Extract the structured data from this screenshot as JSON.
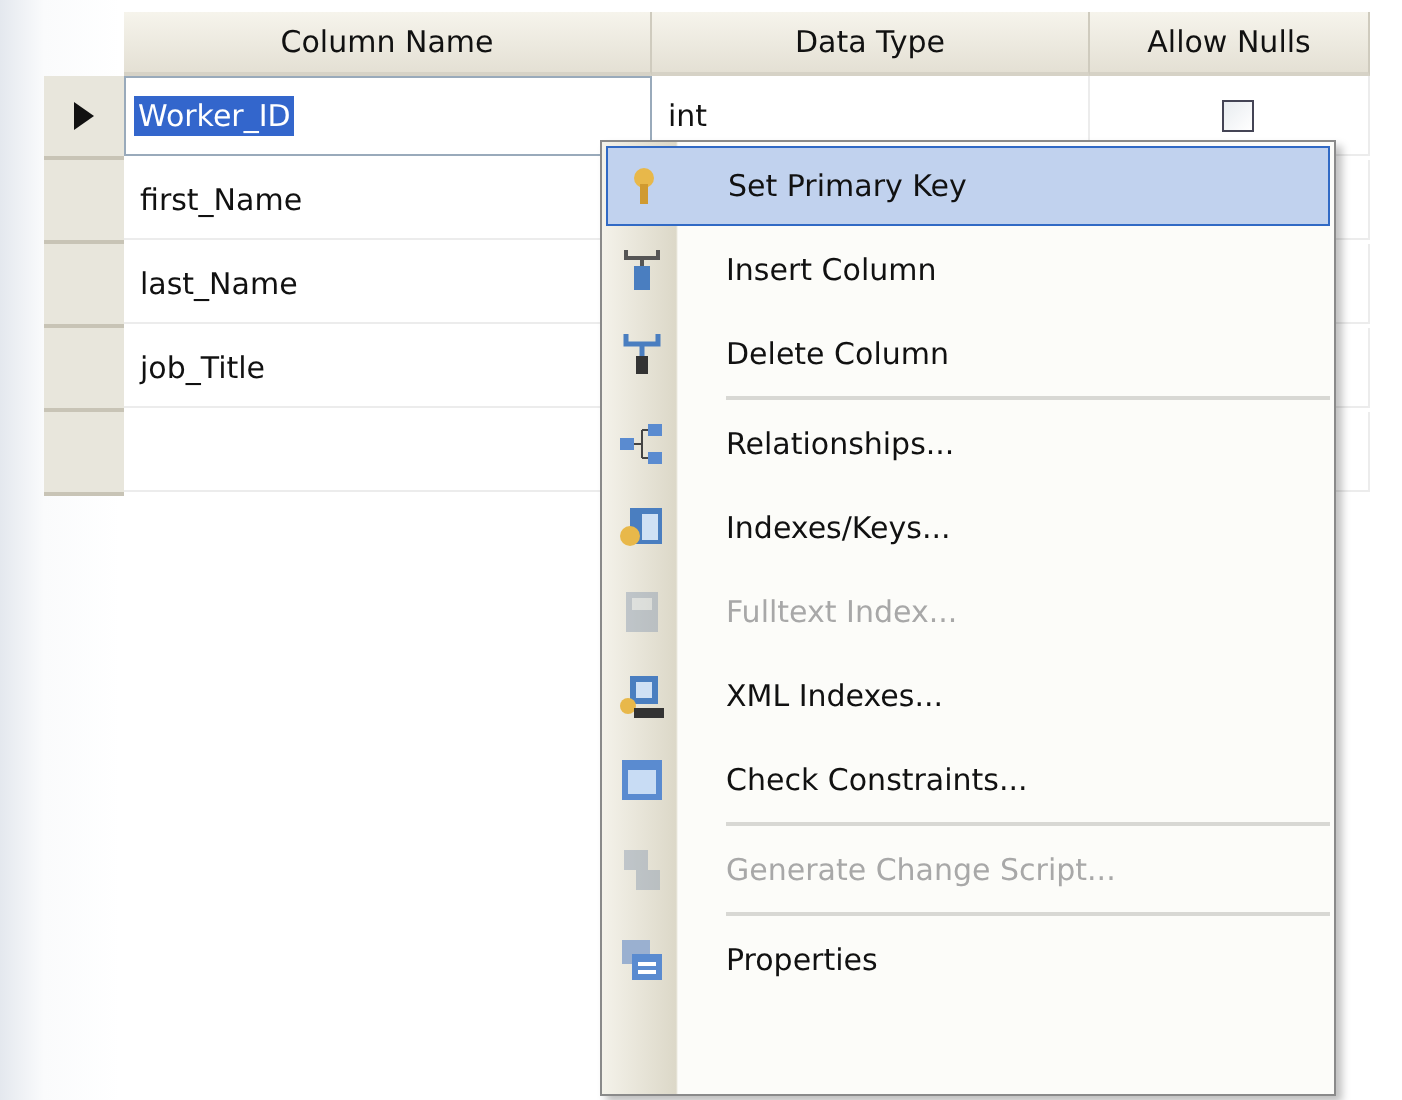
{
  "table": {
    "columns": [
      "Column Name",
      "Data Type",
      "Allow Nulls"
    ],
    "rows": [
      {
        "selected": true,
        "column_name": "Worker_ID",
        "data_type": "int",
        "allow_nulls": false
      },
      {
        "selected": false,
        "column_name": "first_Name"
      },
      {
        "selected": false,
        "column_name": "last_Name"
      },
      {
        "selected": false,
        "column_name": "job_Title"
      },
      {
        "selected": false
      }
    ]
  },
  "context_menu": {
    "items": [
      {
        "label": "Set Primary Key",
        "selected": true,
        "disabled": false
      },
      {
        "label": "Insert Column",
        "selected": false,
        "disabled": false
      },
      {
        "label": "Delete Column",
        "selected": false,
        "disabled": false,
        "separator_after": true
      },
      {
        "label": "Relationships...",
        "selected": false,
        "disabled": false
      },
      {
        "label": "Indexes/Keys...",
        "selected": false,
        "disabled": false
      },
      {
        "label": "Fulltext Index...",
        "selected": false,
        "disabled": true
      },
      {
        "label": "XML Indexes...",
        "selected": false,
        "disabled": false
      },
      {
        "label": "Check Constraints...",
        "selected": false,
        "disabled": false,
        "separator_after": true
      },
      {
        "label": "Generate Change Script...",
        "selected": false,
        "disabled": true,
        "separator_after": true
      },
      {
        "label": "Properties",
        "selected": false,
        "disabled": false
      }
    ]
  }
}
